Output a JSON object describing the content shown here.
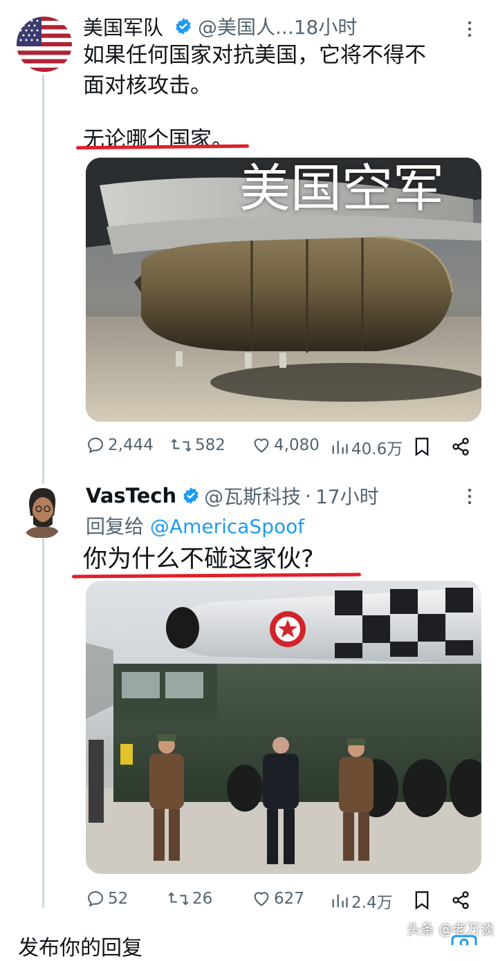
{
  "tweet1": {
    "name": "美国军队",
    "handle_time": "@美国人...18小时",
    "text_line1": "如果任何国家对抗美国，它将不得不",
    "text_line2": "面对核攻击。",
    "text_line3": "无论哪个国家。",
    "media_overlay": "美国空军",
    "stats": {
      "replies": "2,444",
      "retweets": "582",
      "likes": "4,080",
      "views": "40.6万"
    }
  },
  "tweet2": {
    "name": "VasTech",
    "handle": "@瓦斯科技",
    "dot": "·",
    "time": "17小时",
    "reply_to_label": "回复给",
    "reply_to_handle": "@AmericaSpoof",
    "text": "你为什么不碰这家伙?",
    "stats": {
      "replies": "52",
      "retweets": "26",
      "likes": "627",
      "views": "2.4万"
    }
  },
  "footer": {
    "reply_prompt": "发布你的回复",
    "watermark": "头条 @老万谈"
  },
  "colors": {
    "accent": "#1d9bf0",
    "underline": "#e0202a",
    "muted": "#536471"
  }
}
